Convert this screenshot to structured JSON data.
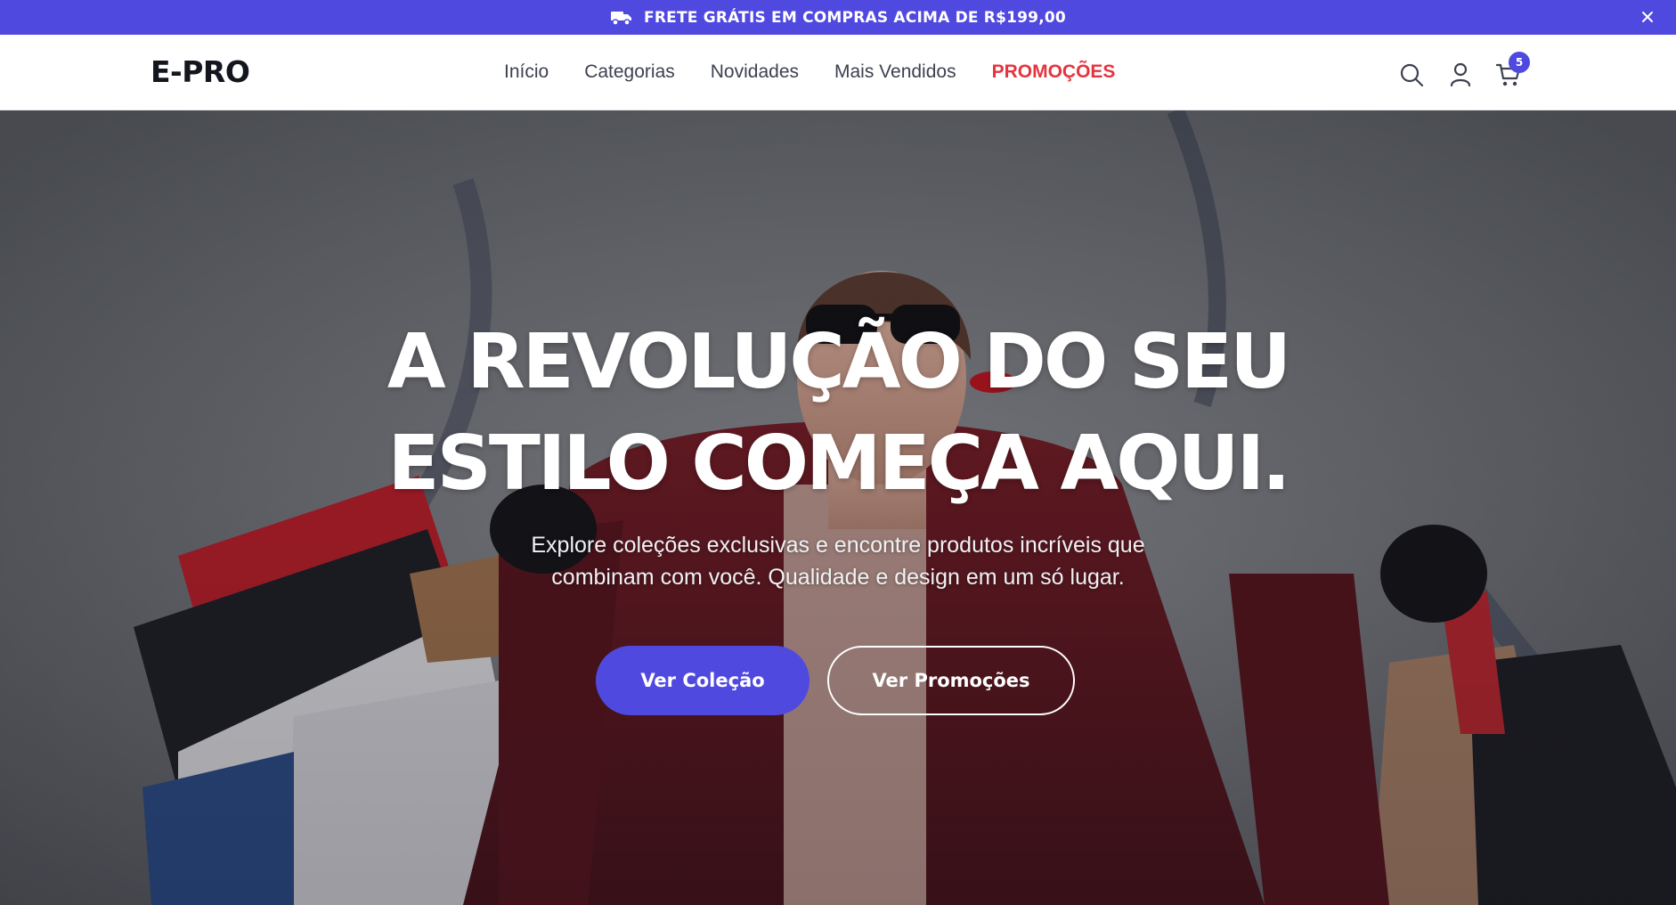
{
  "announcement": {
    "text": "FRETE GRÁTIS EM COMPRAS ACIMA DE R$199,00",
    "icon": "truck-icon",
    "close_icon": "close-icon"
  },
  "header": {
    "logo": "E-PRO",
    "nav": [
      {
        "label": "Início"
      },
      {
        "label": "Categorias"
      },
      {
        "label": "Novidades"
      },
      {
        "label": "Mais Vendidos"
      },
      {
        "label": "PROMOÇÕES",
        "highlight_color": "#e5343f"
      }
    ],
    "icons": [
      "search-icon",
      "user-icon",
      "cart-icon"
    ],
    "cart_count": "5"
  },
  "hero": {
    "title_line1": "A REVOLUÇÃO DO SEU",
    "title_line2": "ESTILO COMEÇA AQUI.",
    "subtitle_line1": "Explore coleções exclusivas e encontre produtos incríveis que",
    "subtitle_line2": "combinam com você. Qualidade e design em um só lugar.",
    "primary_button": "Ver Coleção",
    "secondary_button": "Ver Promoções"
  },
  "colors": {
    "accent": "#5049e0",
    "promo": "#e5343f",
    "text_dark": "#14161f"
  }
}
